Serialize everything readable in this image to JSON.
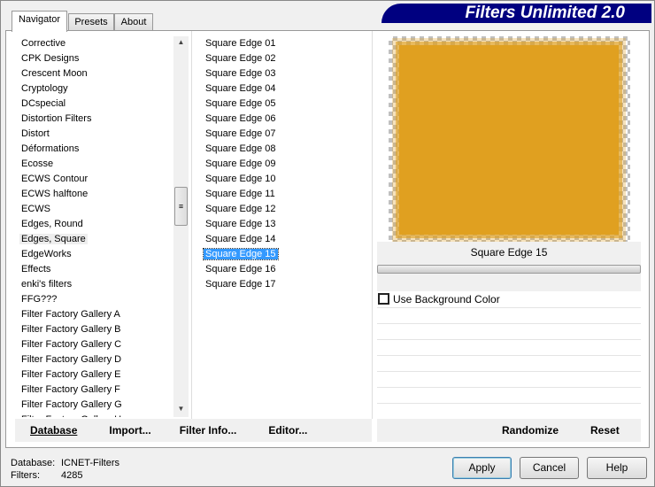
{
  "banner": "Filters Unlimited 2.0",
  "tabs": [
    "Navigator",
    "Presets",
    "About"
  ],
  "categories": [
    "Corrective",
    "CPK Designs",
    "Crescent Moon",
    "Cryptology",
    "DCspecial",
    "Distortion Filters",
    "Distort",
    "Déformations",
    "Ecosse",
    "ECWS Contour",
    "ECWS halftone",
    "ECWS",
    "Edges, Round",
    "Edges, Square",
    "EdgeWorks",
    "Effects",
    "enki's filters",
    "FFG???",
    "Filter Factory Gallery A",
    "Filter Factory Gallery B",
    "Filter Factory Gallery C",
    "Filter Factory Gallery D",
    "Filter Factory Gallery E",
    "Filter Factory Gallery F",
    "Filter Factory Gallery G",
    "Filter Factory Gallery H"
  ],
  "selected_category": "Edges, Square",
  "filters": [
    "Square Edge 01",
    "Square Edge 02",
    "Square Edge 03",
    "Square Edge 04",
    "Square Edge 05",
    "Square Edge 06",
    "Square Edge 07",
    "Square Edge 08",
    "Square Edge 09",
    "Square Edge 10",
    "Square Edge 11",
    "Square Edge 12",
    "Square Edge 13",
    "Square Edge 14",
    "Square Edge 15",
    "Square Edge 16",
    "Square Edge 17"
  ],
  "selected_filter": "Square Edge 15",
  "preview": {
    "filter_name": "Square Edge 15",
    "use_bg_label": "Use Background Color",
    "use_bg_checked": false,
    "fill_color": "#e0a020"
  },
  "left_buttons": {
    "database": "Database",
    "import": "Import...",
    "filter_info": "Filter Info...",
    "editor": "Editor..."
  },
  "right_buttons": {
    "randomize": "Randomize",
    "reset": "Reset"
  },
  "status": {
    "database_label": "Database:",
    "database_value": "ICNET-Filters",
    "filters_label": "Filters:",
    "filters_value": "4285"
  },
  "dialog": {
    "apply": "Apply",
    "cancel": "Cancel",
    "help": "Help"
  }
}
